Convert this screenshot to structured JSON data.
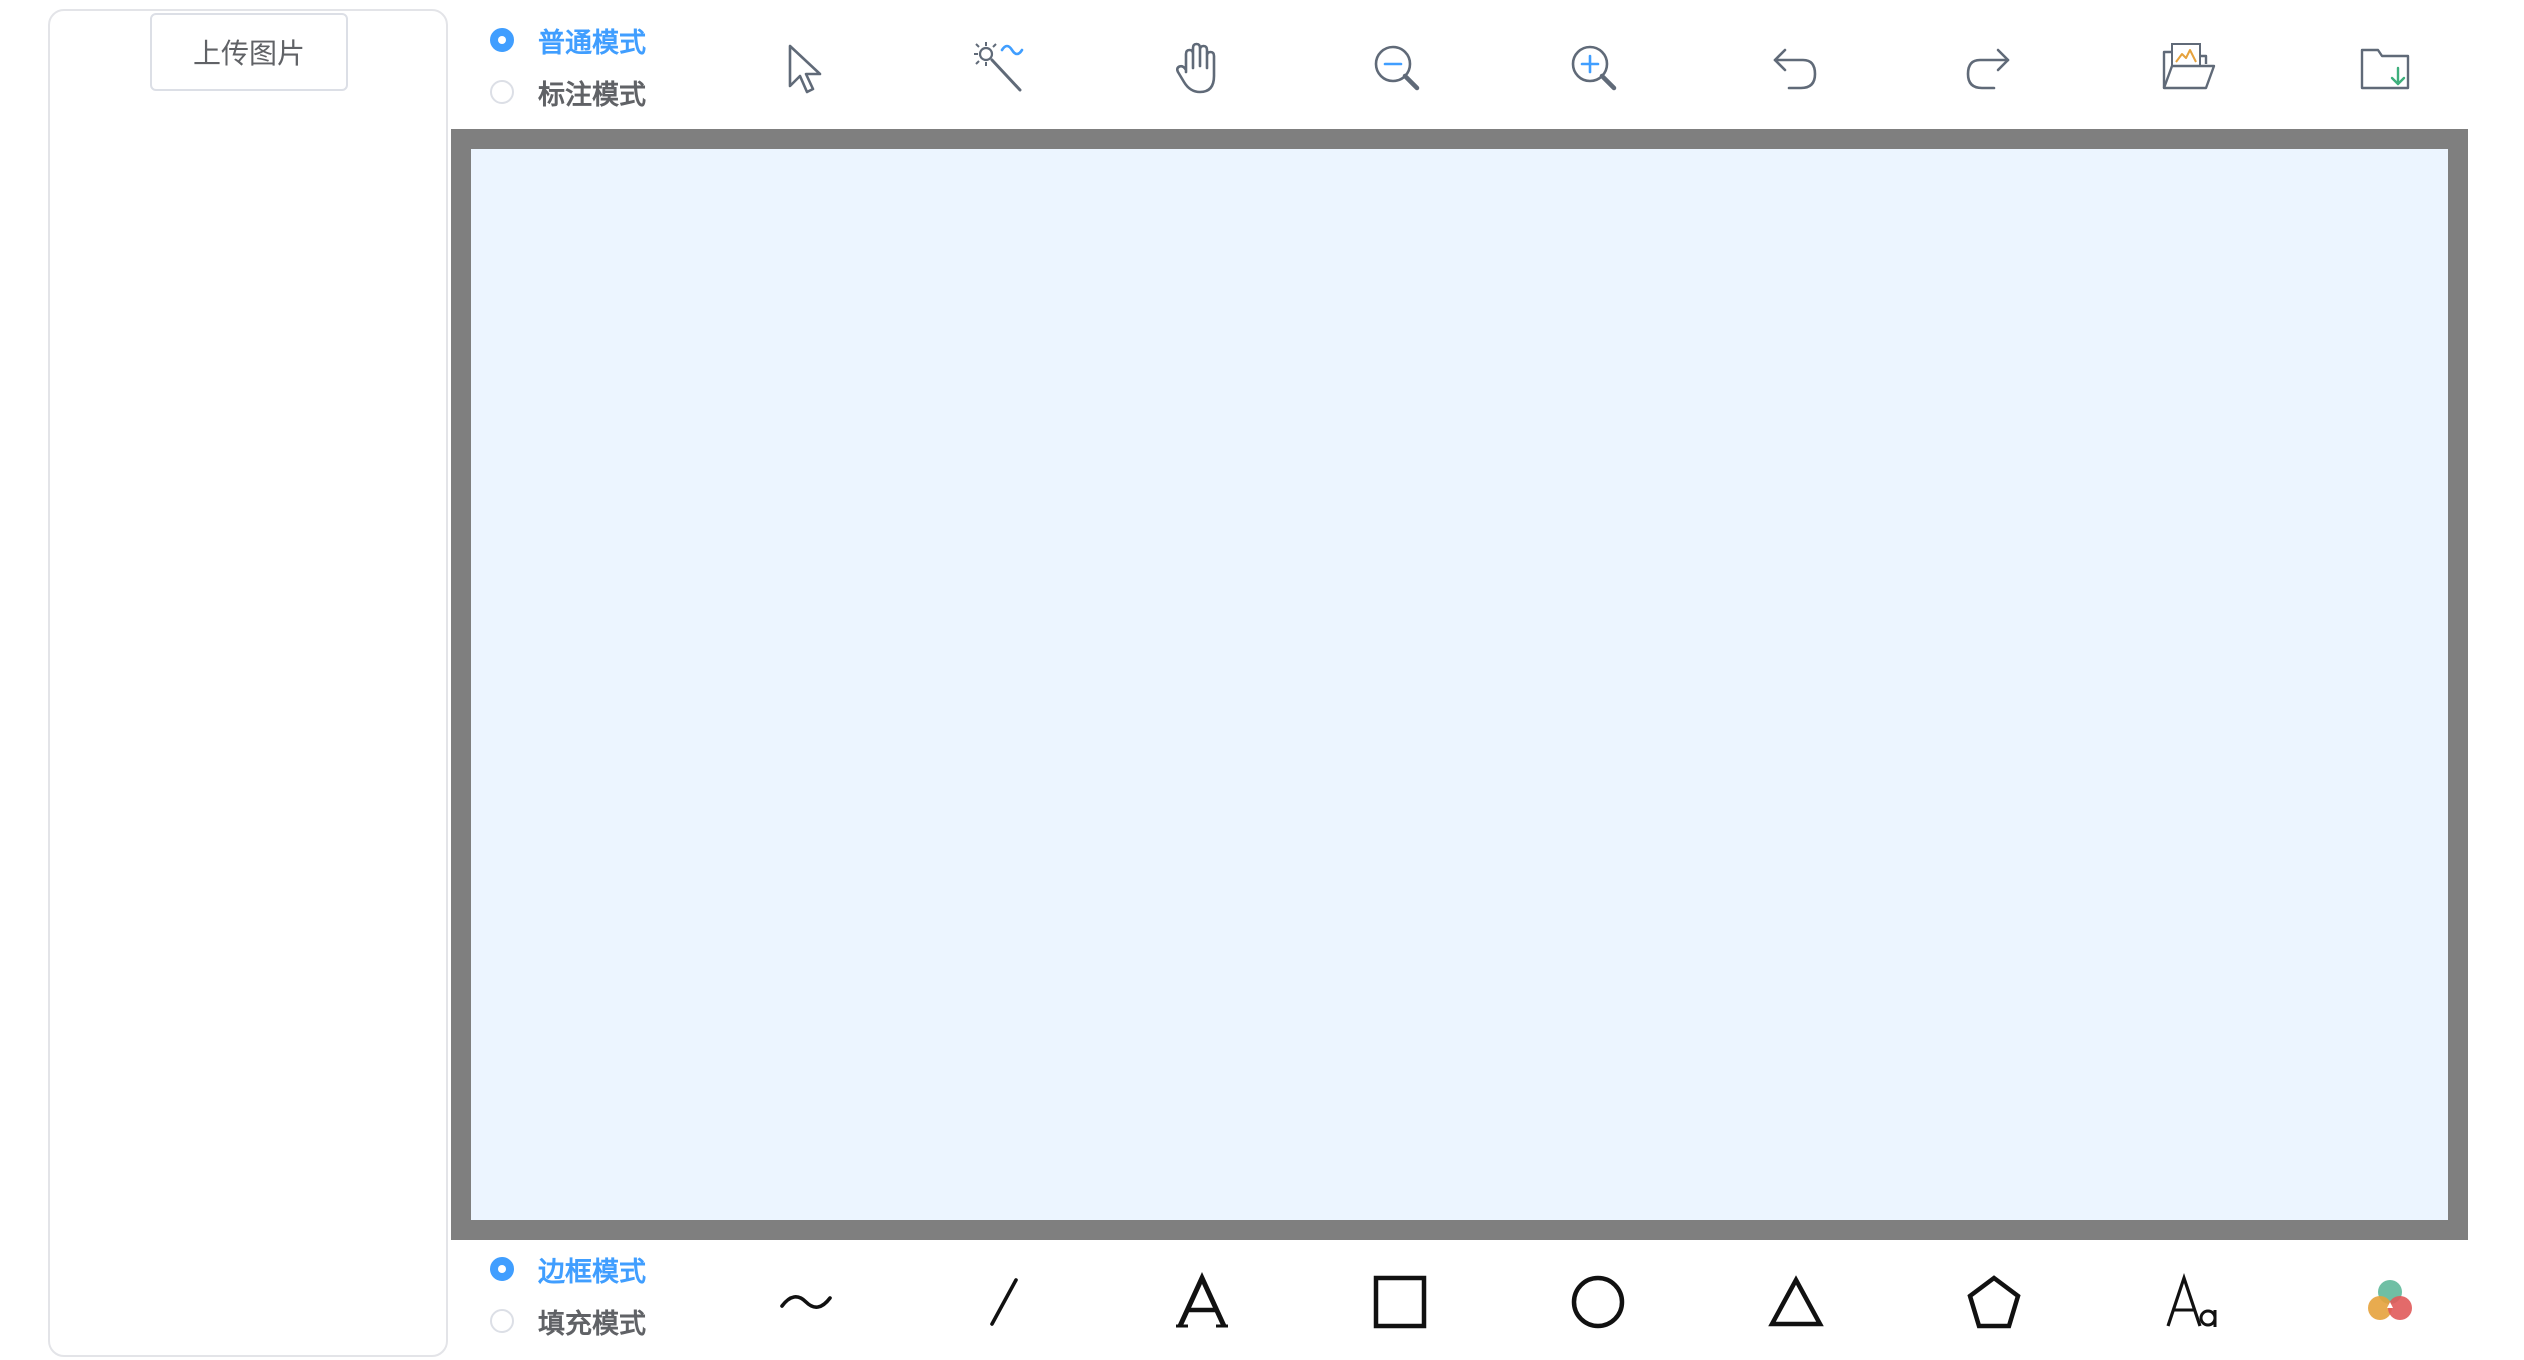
{
  "sidebar": {
    "upload_label": "上传图片"
  },
  "mode_toggle": {
    "options": [
      {
        "label": "普通模式",
        "selected": true
      },
      {
        "label": "标注模式",
        "selected": false
      }
    ]
  },
  "style_toggle": {
    "options": [
      {
        "label": "边框模式",
        "selected": true
      },
      {
        "label": "填充模式",
        "selected": false
      }
    ]
  },
  "top_tools": [
    {
      "icon": "pointer-select-icon"
    },
    {
      "icon": "magic-wand-icon"
    },
    {
      "icon": "hand-pan-icon"
    },
    {
      "icon": "zoom-out-icon"
    },
    {
      "icon": "zoom-in-icon"
    },
    {
      "icon": "undo-icon"
    },
    {
      "icon": "redo-icon"
    },
    {
      "icon": "open-image-folder-icon"
    },
    {
      "icon": "save-folder-icon"
    }
  ],
  "draw_tools": [
    {
      "icon": "freehand-curve-icon"
    },
    {
      "icon": "line-icon"
    },
    {
      "icon": "text-icon"
    },
    {
      "icon": "rectangle-icon"
    },
    {
      "icon": "circle-icon"
    },
    {
      "icon": "triangle-icon"
    },
    {
      "icon": "pentagon-icon"
    },
    {
      "icon": "font-size-icon"
    },
    {
      "icon": "color-palette-icon"
    }
  ],
  "colors": {
    "accent": "#409eff",
    "frame": "#7f7f7f",
    "canvas": "#ecf5ff",
    "icon_stroke": "#606a78"
  }
}
